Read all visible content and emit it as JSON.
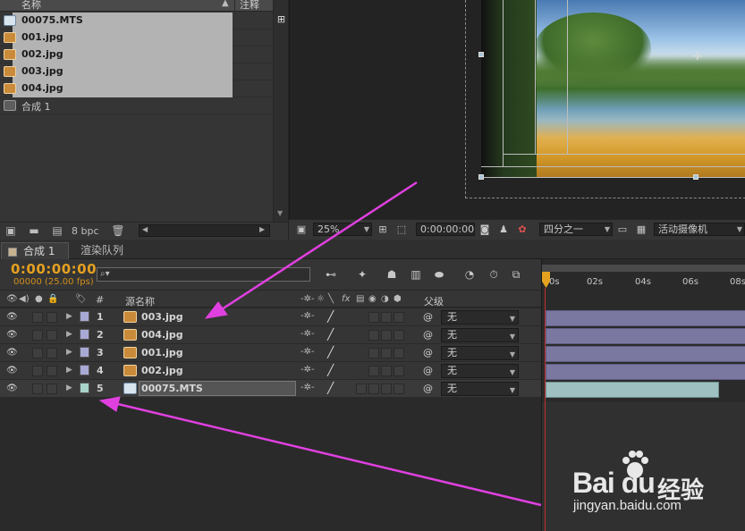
{
  "project": {
    "header": {
      "name_col": "名称",
      "note_col": "注释"
    },
    "items": [
      {
        "name": "00075.MTS",
        "type": "mts",
        "selected": true
      },
      {
        "name": "001.jpg",
        "type": "jpg",
        "selected": true
      },
      {
        "name": "002.jpg",
        "type": "jpg",
        "selected": true
      },
      {
        "name": "003.jpg",
        "type": "jpg",
        "selected": true
      },
      {
        "name": "004.jpg",
        "type": "jpg",
        "selected": true
      },
      {
        "name": "合成 1",
        "type": "comp",
        "selected": false
      }
    ],
    "footer": {
      "bpc": "8 bpc"
    }
  },
  "viewer": {
    "toolbar": {
      "zoom": "25%",
      "timecode": "0:00:00:00",
      "resolution": "四分之一",
      "camera": "活动摄像机"
    }
  },
  "timeline": {
    "tabs": {
      "comp": "合成 1",
      "render": "渲染队列"
    },
    "timecode": "0:00:00:00",
    "frames": "00000 (25.00 fps)",
    "search_placeholder": "⌕▾",
    "columns": {
      "num": "#",
      "source": "源名称",
      "parent": "父级"
    },
    "layers": [
      {
        "num": "1",
        "name": "003.jpg",
        "type": "jpg",
        "label_color": "#a9a9d6",
        "parent": "无"
      },
      {
        "num": "2",
        "name": "004.jpg",
        "type": "jpg",
        "label_color": "#a9a9d6",
        "parent": "无"
      },
      {
        "num": "3",
        "name": "001.jpg",
        "type": "jpg",
        "label_color": "#a9a9d6",
        "parent": "无"
      },
      {
        "num": "4",
        "name": "002.jpg",
        "type": "jpg",
        "label_color": "#a9a9d6",
        "parent": "无"
      },
      {
        "num": "5",
        "name": "00075.MTS",
        "type": "mts",
        "label_color": "#a8d3c8",
        "parent": "无"
      }
    ],
    "ruler_ticks": [
      "0s",
      "02s",
      "04s",
      "06s",
      "08s"
    ]
  },
  "watermark": {
    "brand": "Bai  du",
    "cn": "经验",
    "url": "jingyan.baidu.com"
  },
  "colors": {
    "accent_orange": "#e5a020",
    "arrow_magenta": "#e040e0",
    "cti_red": "#c03030"
  }
}
